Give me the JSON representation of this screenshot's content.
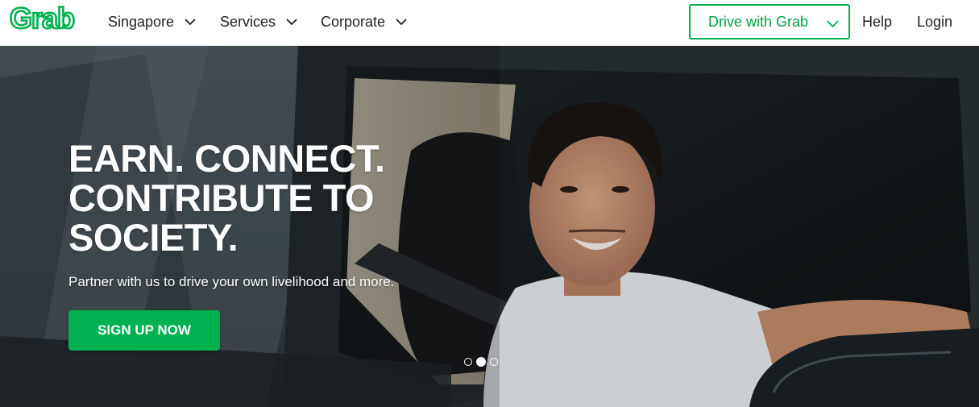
{
  "brand": {
    "logo_text": "Grab",
    "accent": "#00b14f"
  },
  "nav": {
    "items": [
      {
        "label": "Singapore"
      },
      {
        "label": "Services"
      },
      {
        "label": "Corporate"
      }
    ],
    "drive_button": "Drive with Grab",
    "help": "Help",
    "login": "Login"
  },
  "hero": {
    "headline": [
      "EARN. CONNECT.",
      "CONTRIBUTE TO",
      "SOCIETY."
    ],
    "subtext": "Partner with us to drive your own livelihood and more.",
    "cta": "SIGN UP NOW",
    "carousel": {
      "total": 3,
      "active": 2
    }
  },
  "icons": [
    "chevron-down-icon",
    "grab-logo"
  ]
}
